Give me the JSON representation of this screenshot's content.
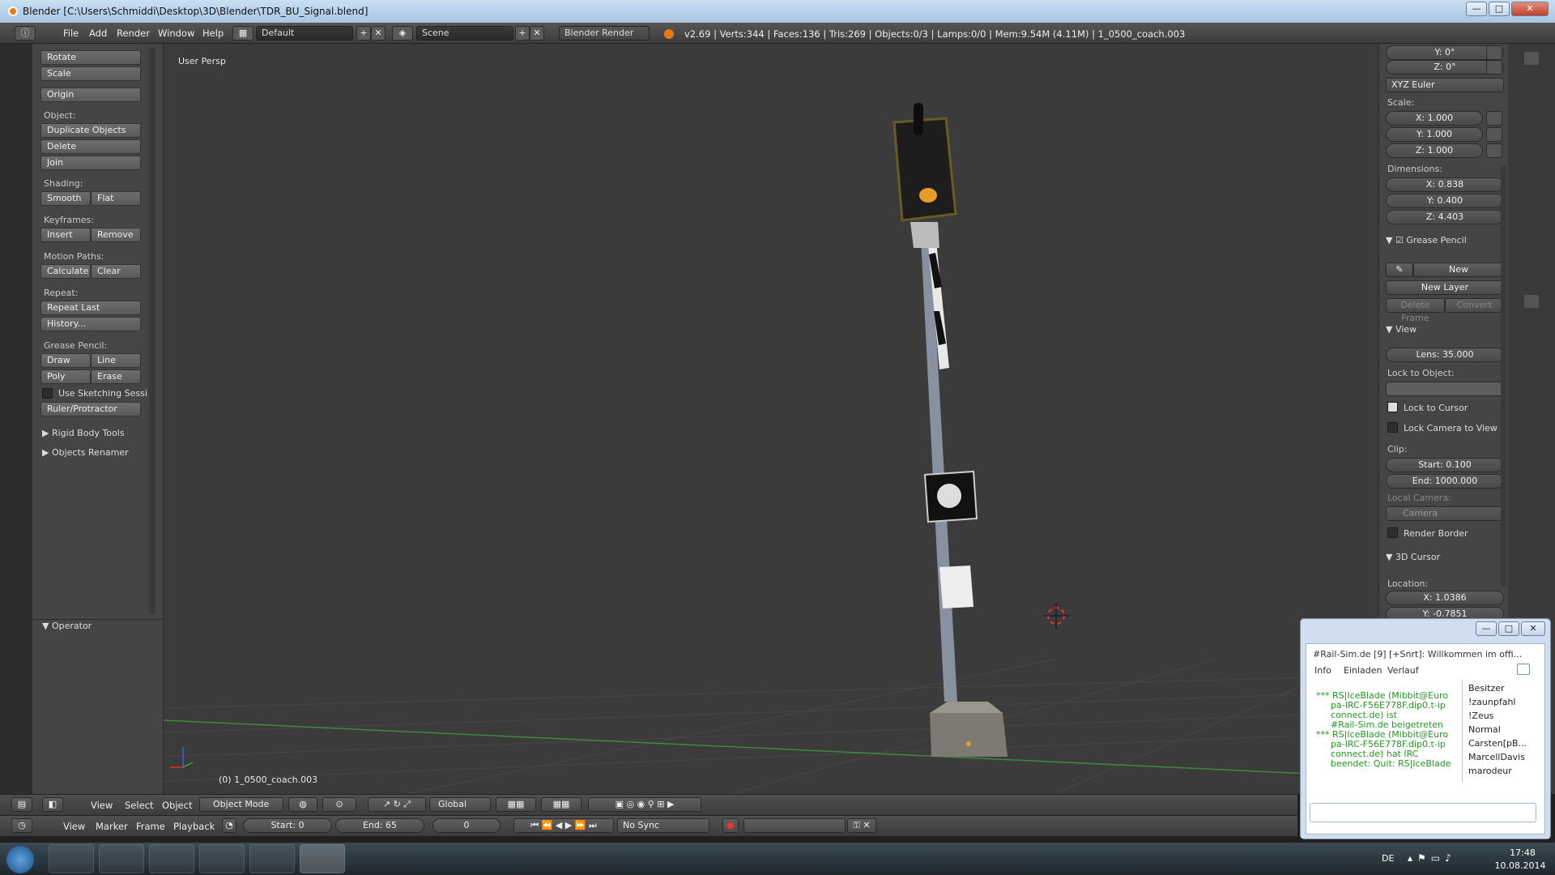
{
  "window": {
    "title": "Blender [C:\\Users\\Schmiddi\\Desktop\\3D\\Blender\\TDR_BU_Signal.blend]",
    "minimize": "—",
    "maximize": "□",
    "close": "✕"
  },
  "infobar": {
    "menus": [
      "File",
      "Add",
      "Render",
      "Window",
      "Help"
    ],
    "layout": "Default",
    "scene": "Scene",
    "engine": "Blender Render",
    "stats": "v2.69 | Verts:344 | Faces:136 | Tris:269 | Objects:0/3 | Lamps:0/0 | Mem:9.54M (4.11M) | 1_0500_coach.003",
    "add_icon": "+",
    "close_icon": "✕"
  },
  "toolshelf": {
    "transform": [
      "Rotate",
      "Scale"
    ],
    "origin": "Origin",
    "object_label": "Object:",
    "duplicate": "Duplicate Objects",
    "delete": "Delete",
    "join": "Join",
    "shading_label": "Shading:",
    "smooth": "Smooth",
    "flat": "Flat",
    "keyframes_label": "Keyframes:",
    "insert": "Insert",
    "remove": "Remove",
    "motion_label": "Motion Paths:",
    "calculate": "Calculate",
    "clear": "Clear",
    "repeat_label": "Repeat:",
    "repeat_last": "Repeat Last",
    "history": "History...",
    "gp_label": "Grease Pencil:",
    "draw": "Draw",
    "line": "Line",
    "poly": "Poly",
    "erase": "Erase",
    "sketching": "Use Sketching Sessi",
    "ruler": "Ruler/Protractor",
    "rigid": "Rigid Body Tools",
    "renamer": "Objects Renamer",
    "operator": "Operator"
  },
  "viewport": {
    "persp": "User Persp",
    "object_info": "(0) 1_0500_coach.003"
  },
  "nprops": {
    "rot_y": "Y: 0°",
    "rot_z": "Z: 0°",
    "rot_mode": "XYZ Euler",
    "scale_label": "Scale:",
    "scale_x": "X: 1.000",
    "scale_y": "Y: 1.000",
    "scale_z": "Z: 1.000",
    "dim_label": "Dimensions:",
    "dim_x": "X: 0.838",
    "dim_y": "Y: 0.400",
    "dim_z": "Z: 4.403",
    "gp_panel": "Grease Pencil",
    "new": "New",
    "new_layer": "New Layer",
    "delete_frame": "Delete Frame",
    "convert": "Convert",
    "view_panel": "View",
    "lens": "Lens: 35.000",
    "lock_obj": "Lock to Object:",
    "lock_cursor": "Lock to Cursor",
    "lock_cam": "Lock Camera to View",
    "clip": "Clip:",
    "clip_start": "Start: 0.100",
    "clip_end": "End: 1000.000",
    "local_cam": "Local Camera:",
    "camera": "Camera",
    "render_border": "Render Border",
    "cursor_panel": "3D Cursor",
    "location": "Location:",
    "loc_x": "X: 1.0386",
    "loc_y": "Y: -0.7851"
  },
  "header3d": {
    "view": "View",
    "select": "Select",
    "object": "Object",
    "mode": "Object Mode",
    "orientation": "Global"
  },
  "timeline": {
    "view": "View",
    "marker": "Marker",
    "frame": "Frame",
    "playback": "Playback",
    "start": "Start: 0",
    "end": "End: 65",
    "current": "0",
    "sync": "No Sync"
  },
  "chat": {
    "title": "#Rail-Sim.de [9] [+Snrt]: Willkommen im offi...",
    "tabs": [
      "Info",
      "Einladen",
      "Verlauf"
    ],
    "lines": [
      "*** RS|IceBlade (Mibbit@Euro",
      "pa-IRC-F56E778F.dip0.t-ip",
      "connect.de) ist",
      "#Rail-Sim.de beigetreten",
      "*** RS|IceBlade (Mibbit@Euro",
      "pa-IRC-F56E778F.dip0.t-ip",
      "connect.de) hat IRC",
      "beendet: Quit: RS|IceBlade"
    ],
    "nicks": [
      "Besitzer",
      "!zaunpfahl",
      "!Zeus",
      "Normal",
      "Carsten[pB...",
      "MarcellDavis",
      "marodeur"
    ]
  },
  "taskbar": {
    "lang": "DE",
    "time": "17:48",
    "date": "10.08.2014"
  },
  "colors": {
    "accent": "#e87d0d",
    "panel": "#454545",
    "viewport": "#3b3b3b",
    "grid_x": "#7a2a2a",
    "grid_y": "#3c8a3c"
  }
}
